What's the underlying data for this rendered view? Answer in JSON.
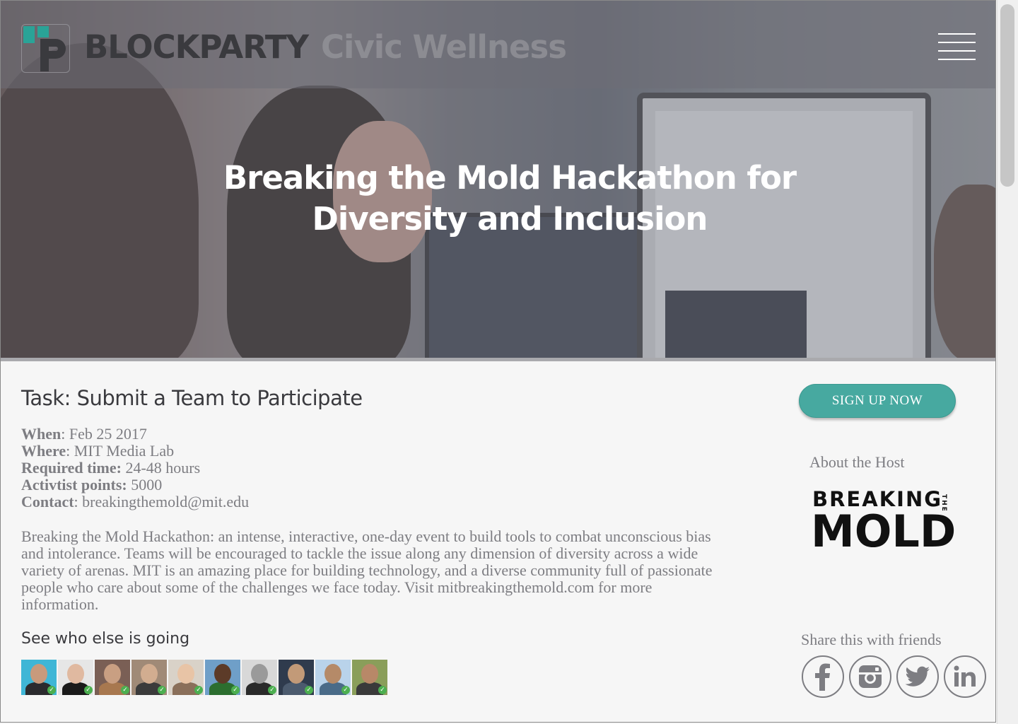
{
  "nav": {
    "brand": "BLOCKPARTY",
    "brand_sub": "Civic Wellness"
  },
  "hero": {
    "title": "Breaking the Mold Hackathon for Diversity and Inclusion"
  },
  "task": {
    "title": "Task: Submit a Team to Participate",
    "details": [
      {
        "label": "When",
        "sep": ": ",
        "value": "Feb 25 2017"
      },
      {
        "label": "Where",
        "sep": ": ",
        "value": "MIT Media Lab"
      },
      {
        "label": "Required time:",
        "sep": " ",
        "value": "24-48 hours"
      },
      {
        "label": "Activtist points:",
        "sep": " ",
        "value": "5000"
      },
      {
        "label": "Contact",
        "sep": ": ",
        "value": "breakingthemold@mit.edu"
      }
    ],
    "description": "Breaking the Mold Hackathon: an intense, interactive, one-day event to build tools to combat unconscious bias and intolerance. Teams will be encouraged to tackle the issue along any dimension of diversity across a wide variety of arenas. MIT is an amazing place for building technology, and a diverse community full of passionate people who care about some of the challenges we face today. Visit mitbreakingthemold.com for more information."
  },
  "going": {
    "title": "See who else is going",
    "attendees": [
      {
        "bg": "#3fb6d6",
        "skin": "#c89a7c",
        "shirt": "#2b2b2e"
      },
      {
        "bg": "#e6e6e6",
        "skin": "#e0b9a0",
        "shirt": "#1a1a1a"
      },
      {
        "bg": "#7a5f55",
        "skin": "#c99f82",
        "shirt": "#a8784f"
      },
      {
        "bg": "#a08a77",
        "skin": "#d2ad90",
        "shirt": "#3b3b3b"
      },
      {
        "bg": "#d9d2c8",
        "skin": "#e8c4a6",
        "shirt": "#8a6f5a"
      },
      {
        "bg": "#6f9fc8",
        "skin": "#5c3b28",
        "shirt": "#2c6e2f"
      },
      {
        "bg": "#d8d8d8",
        "skin": "#9a9a9a",
        "shirt": "#2a2a2a"
      },
      {
        "bg": "#2f3b4d",
        "skin": "#c29a78",
        "shirt": "#4c5b6e"
      },
      {
        "bg": "#b9d3ea",
        "skin": "#b58a68",
        "shirt": "#4a6b88"
      },
      {
        "bg": "#8a9e5a",
        "skin": "#b88868",
        "shirt": "#3a3a3a"
      }
    ]
  },
  "sidebar": {
    "signup_label": "SIGN UP NOW",
    "about_host": "About the Host",
    "host_logo": {
      "line1": "BREAKING",
      "the": "THE",
      "line2": "MOLD"
    },
    "share_title": "Share this with friends",
    "socials": [
      "facebook-icon",
      "instagram-icon",
      "twitter-icon",
      "linkedin-icon"
    ]
  },
  "colors": {
    "accent": "#47a9a0",
    "text_dark": "#3a3a3e",
    "text_muted": "#7d7d82"
  }
}
